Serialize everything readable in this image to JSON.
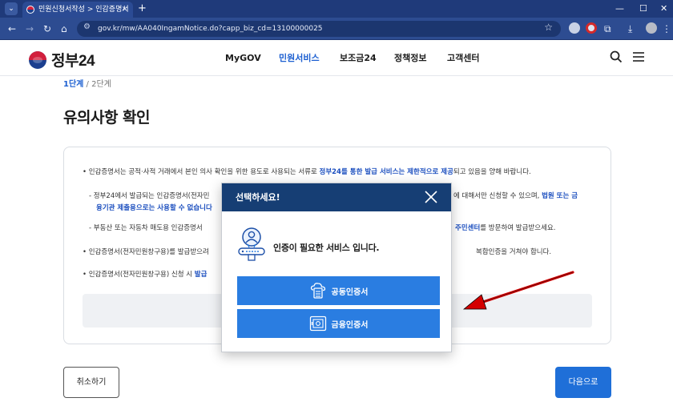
{
  "browser": {
    "tab_title": "민원신청서작성 > 인감증명서",
    "tab_close": "×",
    "new_tab": "+",
    "window_minimize": "—",
    "window_maximize": "☐",
    "window_close": "✕",
    "url": "gov.kr/mw/AA040IngamNotice.do?capp_biz_cd=13100000025"
  },
  "site": {
    "logo_text": "정부24",
    "nav": [
      "MyGOV",
      "민원서비스",
      "보조금24",
      "정책정보",
      "고객센터"
    ],
    "active_nav": "민원서비스"
  },
  "steps": {
    "current": "1단계",
    "separator": " / ",
    "next": "2단계"
  },
  "page_title": "유의사항 확인",
  "notice": {
    "l1_a": "• 인감증명서는 공적·사적 거래에서 본인 의사 확인을 위한 용도로 사용되는 서류로 ",
    "l1_b": "정부24를 통한 발급 서비스는 제한적으로 제공",
    "l1_c": "되고 있음을 양해 바랍니다.",
    "l2_a": "- 정부24에서 발급되는 인감증명서(전자민",
    "l2_b": "에 대해서만 신청할 수 있으며, ",
    "l2_c": "법원 또는 금",
    "l3_a": "융기관 제출용으로는 사용할 수 없습니다",
    "l4_a": "- 부동산 또는 자동차 매도용 인감증명서",
    "l4_b": "주민센터",
    "l4_c": "를 방문하여 발급받으세요.",
    "l5_a": "• 인감증명서(전자민원창구용)를 발급받으려",
    "l5_b": "복합인증을 거쳐야 합니다.",
    "l6_a": "• 인감증명서(전자민원창구용) 신청 시 ",
    "l6_b": "발급"
  },
  "buttons": {
    "cancel": "취소하기",
    "next": "다음으로"
  },
  "modal": {
    "title": "선택하세요!",
    "message": "인증이 필요한 서비스 입니다.",
    "option1": "공동인증서",
    "option2": "금융인증서"
  },
  "colors": {
    "primary_blue": "#1f6fd8",
    "modal_header": "#163e74",
    "cert_button": "#2a7de1",
    "annotation_arrow": "#d40000",
    "browser_frame": "#1f3a7a"
  }
}
